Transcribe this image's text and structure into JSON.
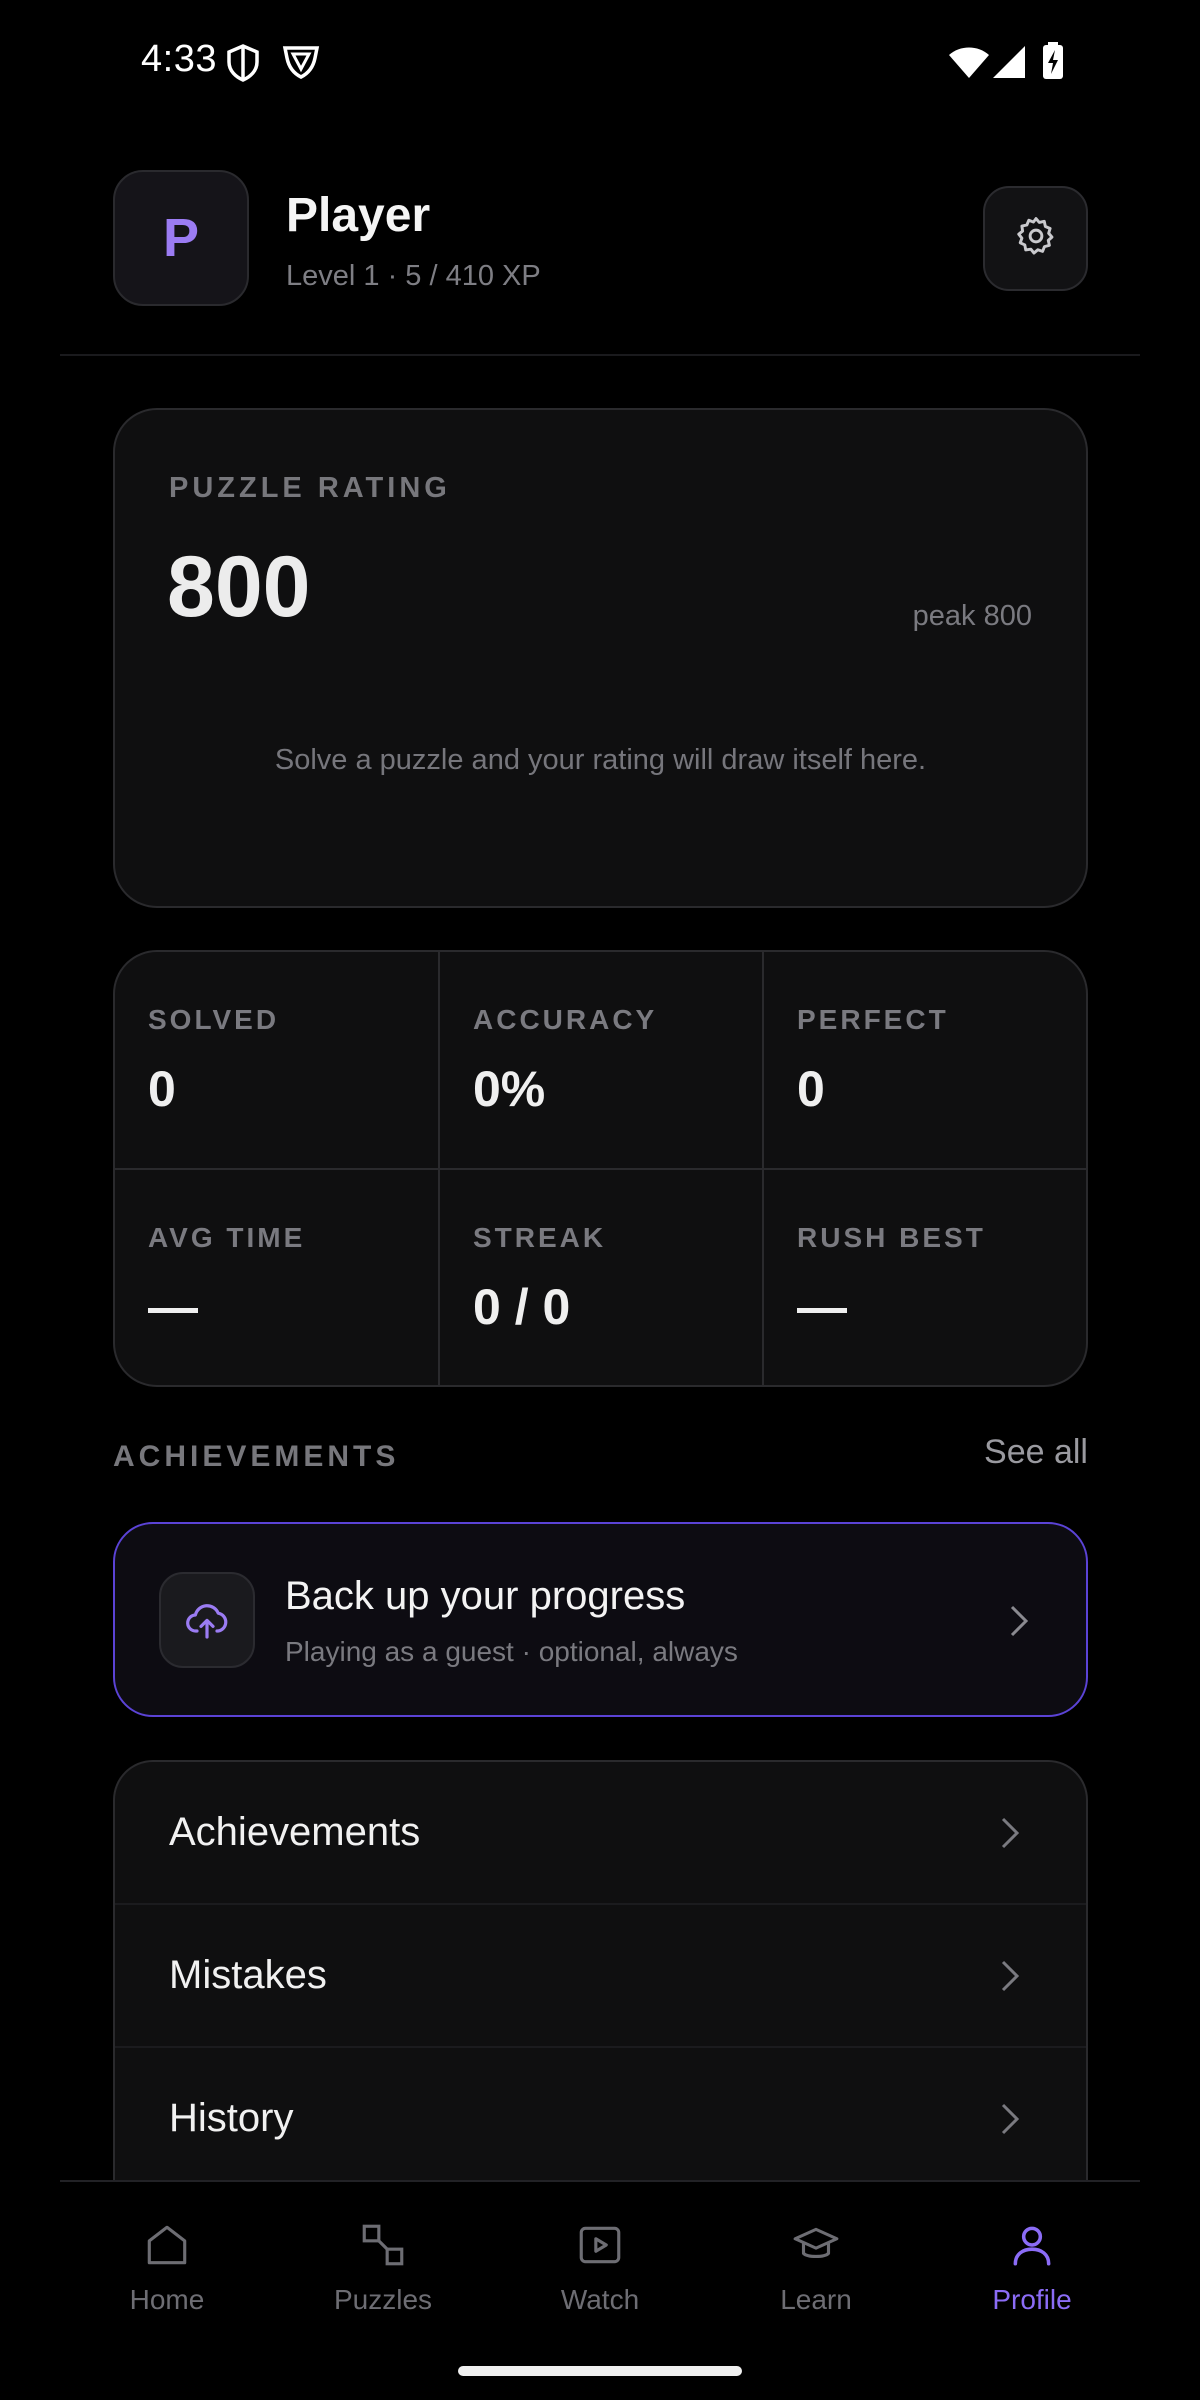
{
  "status_bar": {
    "time": "4:33",
    "icons_left": [
      "shield-icon",
      "vpn-icon"
    ],
    "icons_right": [
      "wifi-icon",
      "signal-icon",
      "battery-charging-icon"
    ]
  },
  "profile": {
    "avatar_initial": "P",
    "name": "Player",
    "level_text": "Level 1 · 5 / 410 XP",
    "settings_icon": "gear-icon"
  },
  "rating": {
    "label": "PUZZLE RATING",
    "value": "800",
    "peak": "peak 800",
    "empty_message": "Solve a puzzle and your rating will draw itself here."
  },
  "stats": [
    {
      "label": "SOLVED",
      "value": "0"
    },
    {
      "label": "ACCURACY",
      "value": "0%"
    },
    {
      "label": "PERFECT",
      "value": "0"
    },
    {
      "label": "AVG TIME",
      "value": "—"
    },
    {
      "label": "STREAK",
      "value": "0 / 0"
    },
    {
      "label": "RUSH BEST",
      "value": "—"
    }
  ],
  "achievements_section": {
    "label": "ACHIEVEMENTS",
    "see_all": "See all"
  },
  "backup": {
    "title": "Back up your progress",
    "subtitle": "Playing as a guest · optional, always",
    "icon": "cloud-upload-icon"
  },
  "menu": [
    {
      "label": "Achievements"
    },
    {
      "label": "Mistakes"
    },
    {
      "label": "History"
    }
  ],
  "bottom_nav": [
    {
      "label": "Home",
      "icon": "home-icon",
      "active": false
    },
    {
      "label": "Puzzles",
      "icon": "puzzles-icon",
      "active": false
    },
    {
      "label": "Watch",
      "icon": "play-icon",
      "active": false
    },
    {
      "label": "Learn",
      "icon": "graduation-cap-icon",
      "active": false
    },
    {
      "label": "Profile",
      "icon": "user-icon",
      "active": true
    }
  ],
  "colors": {
    "accent": "#8b6cf6",
    "background": "#000000",
    "card": "#0f0f10",
    "backup_border": "#5b43d6"
  }
}
